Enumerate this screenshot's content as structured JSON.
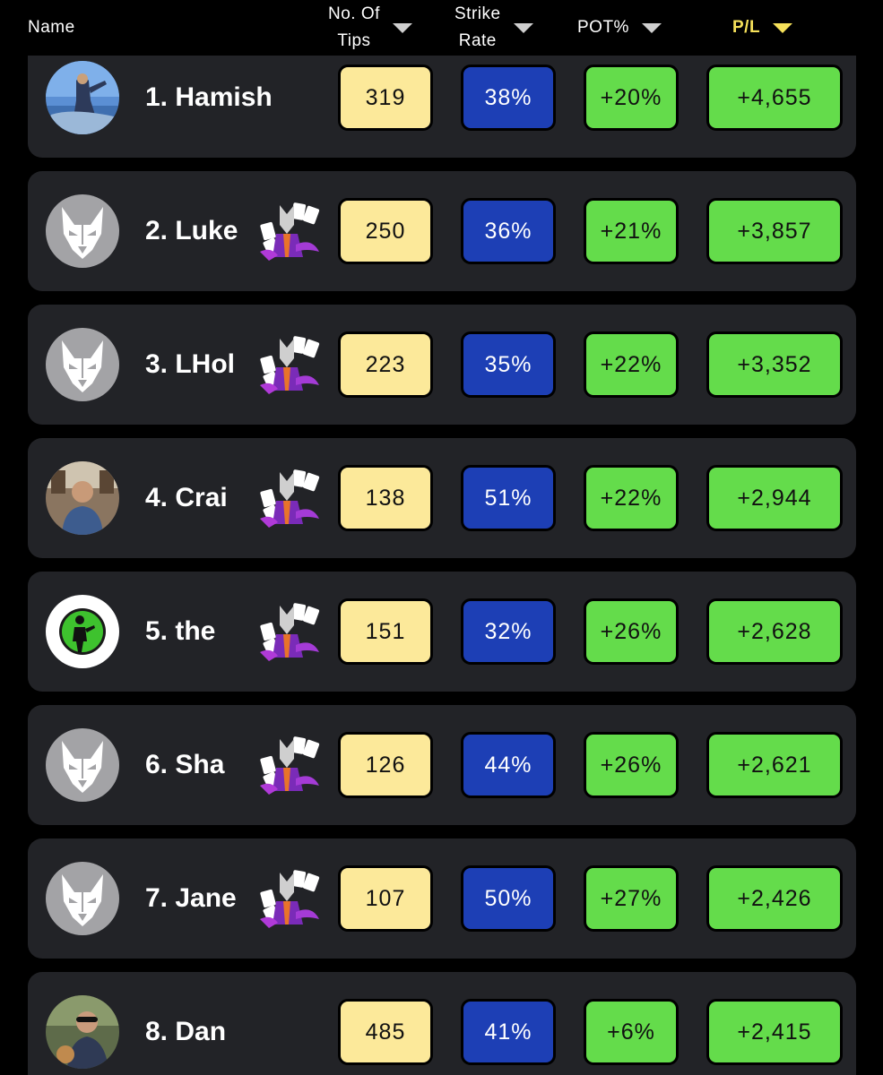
{
  "header": {
    "name": "Name",
    "tips": "No. Of Tips",
    "tips_line1": "No. Of",
    "tips_line2": "Tips",
    "strike_line1": "Strike",
    "strike_line2": "Rate",
    "pot": "POT%",
    "pl": "P/L",
    "active_sort": "P/L"
  },
  "colors": {
    "tips_bg": "#fce99a",
    "strike_bg": "#1d3fb5",
    "pot_bg": "#64dc4b",
    "pl_bg": "#64dc4b",
    "row_bg": "#222327",
    "sort_active": "#f6e15a"
  },
  "rows": [
    {
      "name": "1. Hamish",
      "avatar": "photo-avatar-icon",
      "badge": false,
      "tips": "319",
      "strike": "38%",
      "pot": "+20%",
      "pl": "+4,655"
    },
    {
      "name": "2. Luke",
      "avatar": "wolf-avatar-icon",
      "badge": true,
      "tips": "250",
      "strike": "36%",
      "pot": "+21%",
      "pl": "+3,857"
    },
    {
      "name": "3. LHol",
      "avatar": "wolf-avatar-icon",
      "badge": true,
      "tips": "223",
      "strike": "35%",
      "pot": "+22%",
      "pl": "+3,352"
    },
    {
      "name": "4. Crai",
      "avatar": "photo-avatar-icon",
      "badge": true,
      "tips": "138",
      "strike": "51%",
      "pot": "+22%",
      "pl": "+2,944"
    },
    {
      "name": "5. the",
      "avatar": "green-silhouette-avatar-icon",
      "badge": true,
      "tips": "151",
      "strike": "32%",
      "pot": "+26%",
      "pl": "+2,628"
    },
    {
      "name": "6. Sha",
      "avatar": "wolf-avatar-icon",
      "badge": true,
      "tips": "126",
      "strike": "44%",
      "pot": "+26%",
      "pl": "+2,621"
    },
    {
      "name": "7. Jane",
      "avatar": "wolf-avatar-icon",
      "badge": true,
      "tips": "107",
      "strike": "50%",
      "pot": "+27%",
      "pl": "+2,426"
    },
    {
      "name": "8. Dan",
      "avatar": "photo-avatar-icon",
      "badge": false,
      "tips": "485",
      "strike": "41%",
      "pot": "+6%",
      "pl": "+2,415"
    }
  ]
}
